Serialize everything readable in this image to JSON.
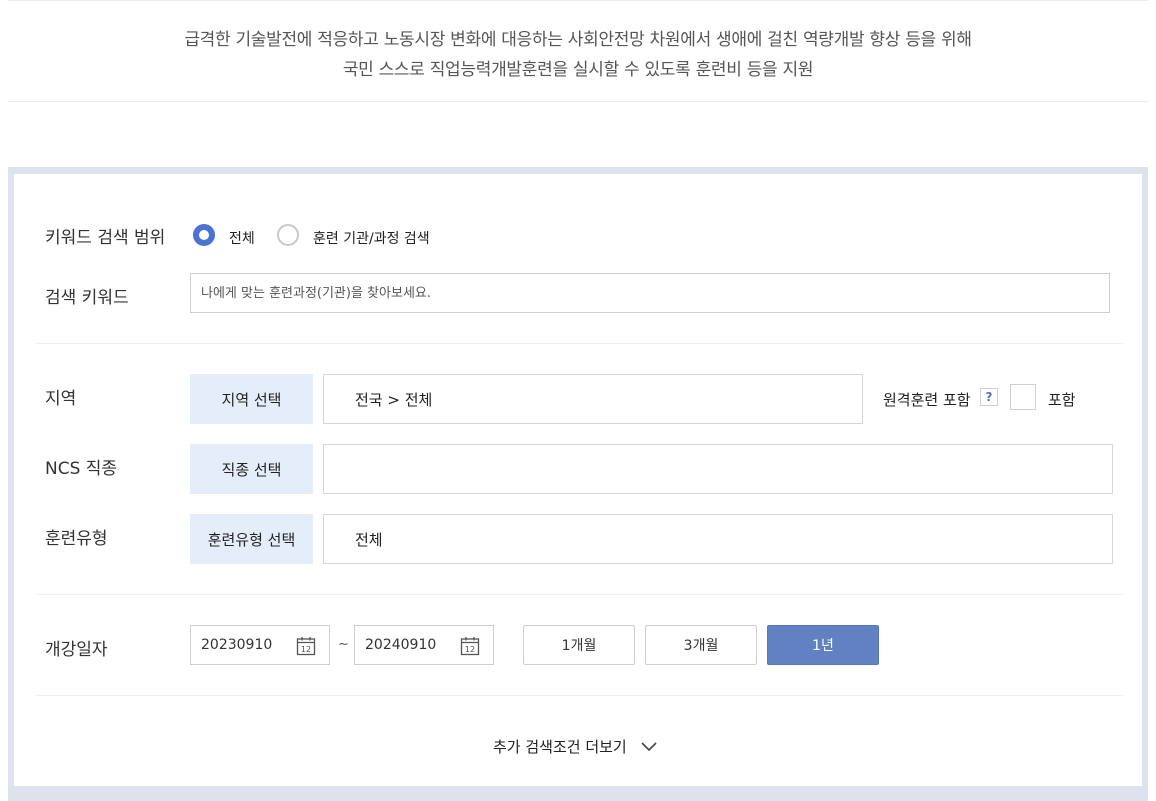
{
  "intro": {
    "line1": "급격한 기술발전에 적응하고 노동시장 변화에 대응하는 사회안전망 차원에서 생애에 걸친 역량개발 향상 등을 위해",
    "line2": "국민 스스로 직업능력개발훈련을 실시할 수 있도록 훈련비 등을 지원"
  },
  "search": {
    "scope_label": "키워드 검색 범위",
    "scope_options": [
      {
        "label": "전체",
        "selected": true
      },
      {
        "label": "훈련 기관/과정 검색",
        "selected": false
      }
    ],
    "keyword_label": "검색 키워드",
    "keyword_placeholder": "나에게 맞는 훈련과정(기관)을 찾아보세요.",
    "keyword_value": ""
  },
  "filters": {
    "region": {
      "label": "지역",
      "button": "지역 선택",
      "value": "전국 > 전체"
    },
    "remote": {
      "label": "원격훈련 포함",
      "help": "?",
      "checkbox_label": "포함",
      "checked": false
    },
    "ncs": {
      "label": "NCS 직종",
      "button": "직종 선택",
      "value": ""
    },
    "training_type": {
      "label": "훈련유형",
      "button": "훈련유형 선택",
      "value": "전체"
    }
  },
  "dates": {
    "label": "개강일자",
    "start": "20230910",
    "separator": "~",
    "end": "20240910",
    "calendar_day": "12",
    "periods": [
      {
        "label": "1개월",
        "active": false
      },
      {
        "label": "3개월",
        "active": false
      },
      {
        "label": "1년",
        "active": true
      }
    ]
  },
  "more": {
    "label": "추가 검색조건 더보기"
  },
  "colors": {
    "accent": "#4d73d1",
    "active_button": "#6281c3",
    "select_bg": "#e4edf9",
    "panel_border": "#dde3ec"
  }
}
